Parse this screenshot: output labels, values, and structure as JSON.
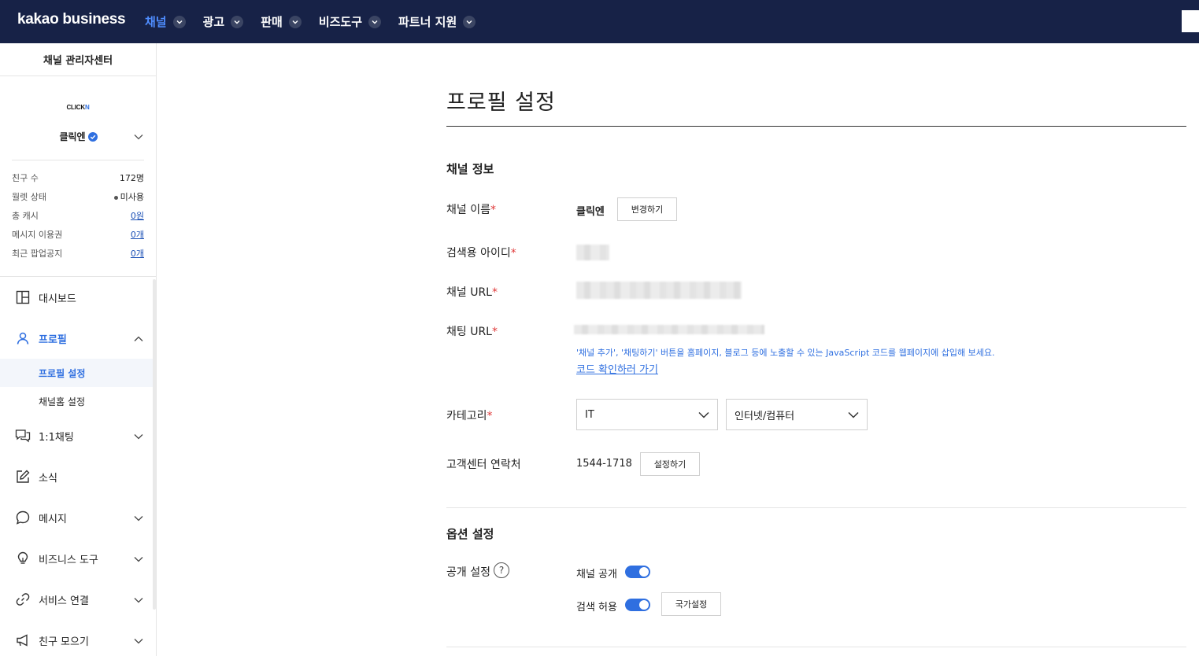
{
  "header": {
    "logo": "kakao business",
    "nav": [
      {
        "label": "채널",
        "active": true
      },
      {
        "label": "광고",
        "active": false
      },
      {
        "label": "판매",
        "active": false
      },
      {
        "label": "비즈도구",
        "active": false
      },
      {
        "label": "파트너 지원",
        "active": false
      }
    ]
  },
  "sidebar": {
    "title": "채널 관리자센터",
    "channel": {
      "logo_text": "CLICK",
      "logo_accent": "N",
      "name": "클릭엔"
    },
    "stats": [
      {
        "label": "친구 수",
        "value": "172명"
      },
      {
        "label": "월렛 상태",
        "value": "미사용"
      },
      {
        "label": "총 캐시",
        "value": "0원"
      },
      {
        "label": "메시지 이용권",
        "value": "0개"
      },
      {
        "label": "최근 팝업공지",
        "value": "0개"
      }
    ],
    "menu": [
      {
        "label": "대시보드",
        "icon": "dashboard-icon"
      },
      {
        "label": "프로필",
        "icon": "person-icon"
      },
      {
        "label": "1:1채팅",
        "icon": "chat-icon"
      },
      {
        "label": "소식",
        "icon": "edit-icon"
      },
      {
        "label": "메시지",
        "icon": "message-icon"
      },
      {
        "label": "비즈니스 도구",
        "icon": "bulb-icon"
      },
      {
        "label": "서비스 연결",
        "icon": "link-icon"
      },
      {
        "label": "친구 모으기",
        "icon": "megaphone-icon"
      }
    ],
    "submenu": [
      {
        "label": "프로필 설정",
        "active": true
      },
      {
        "label": "채널홈 설정",
        "active": false
      }
    ]
  },
  "main": {
    "title": "프로필 설정",
    "channel_info": {
      "section_title": "채널 정보",
      "name_label": "채널 이름",
      "name_value": "클릭엔",
      "change_button": "변경하기",
      "search_id_label": "검색용 아이디",
      "url_label": "채널 URL",
      "chat_url_label": "채팅 URL",
      "hint": "'채널 추가', '채팅하기' 버튼을 홈페이지, 블로그 등에 노출할 수 있는 JavaScript 코드를 웹페이지에 삽입해 보세요.",
      "code_link": "코드 확인하러 가기",
      "category_label": "카테고리",
      "category_1": "IT",
      "category_2": "인터넷/컴퓨터",
      "contact_label": "고객센터 연락처",
      "contact_value": "1544-1718",
      "contact_button": "설정하기"
    },
    "options": {
      "section_title": "옵션 설정",
      "visibility_label": "공개 설정",
      "help": "?",
      "channel_public_label": "채널 공개",
      "search_allow_label": "검색 허용",
      "country_button": "국가설정"
    },
    "required_mark": "*"
  },
  "colors": {
    "topbar": "#172247",
    "accent": "#2f6fe0",
    "required": "#e03a3a"
  }
}
